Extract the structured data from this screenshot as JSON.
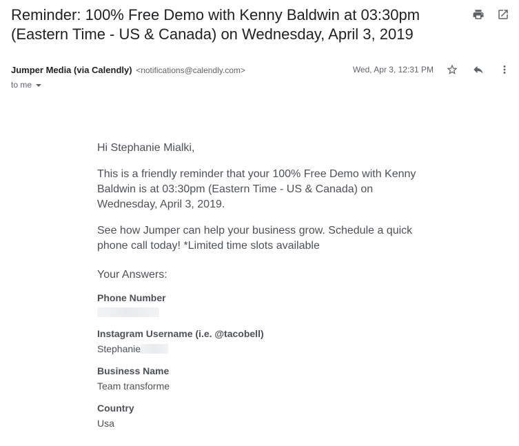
{
  "email": {
    "subject": "Reminder: 100% Free Demo with Kenny Baldwin at 03:30pm (Eastern Time - US & Canada) on Wednesday, April 3, 2019",
    "sender_name": "Jumper Media (via Calendly)",
    "sender_email": "<notifications@calendly.com>",
    "to": "to me",
    "date": "Wed, Apr 3, 12:31 PM"
  },
  "body": {
    "greeting": "Hi Stephanie Mialki,",
    "para1": "This is a friendly reminder that your 100% Free Demo with Kenny Baldwin is at 03:30pm (Eastern Time - US & Canada) on Wednesday, April 3, 2019.",
    "para2": "See how Jumper can help your business grow. Schedule a quick phone call today! *Limited time slots available",
    "answers_title": "Your Answers:",
    "answers": [
      {
        "question": "Phone Number",
        "answer": ""
      },
      {
        "question": "Instagram Username (i.e. @tacobell)",
        "answer": "Stephanie"
      },
      {
        "question": "Business Name",
        "answer": "Team transforme"
      },
      {
        "question": "Country",
        "answer": "Usa"
      }
    ]
  },
  "icons": [
    "print-icon",
    "open-in-new-window-icon",
    "star-icon",
    "reply-icon",
    "more-options-icon"
  ]
}
